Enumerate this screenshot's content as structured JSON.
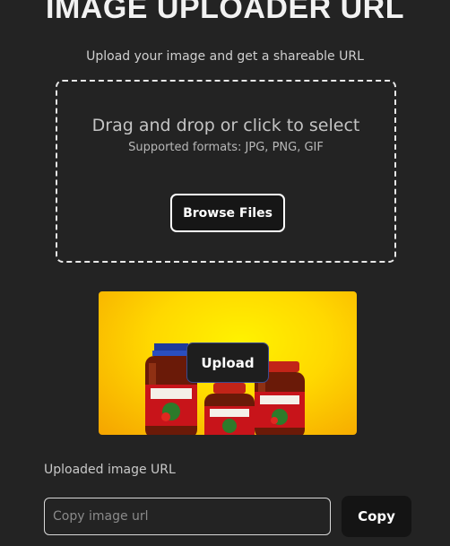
{
  "header": {
    "title": "IMAGE UPLOADER URL",
    "subtitle": "Upload your image and get a shareable URL"
  },
  "dropzone": {
    "title": "Drag and drop or click to select",
    "formats": "Supported formats: JPG, PNG, GIF",
    "browse_label": "Browse Files"
  },
  "preview": {
    "upload_label": "Upload",
    "background_color": "#ffd800"
  },
  "result": {
    "label": "Uploaded image URL",
    "input_value": "",
    "input_placeholder": "Copy image url",
    "copy_label": "Copy"
  }
}
